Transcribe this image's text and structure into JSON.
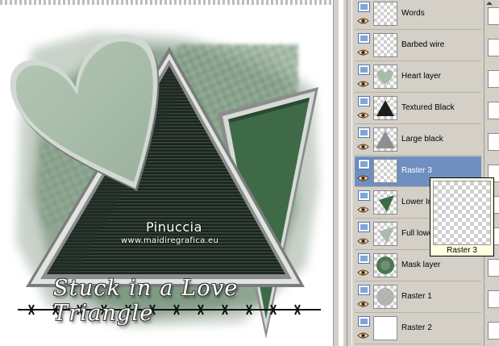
{
  "canvas": {
    "watermark_name": "Pinuccia",
    "watermark_url": "www.maidiregrafica.eu",
    "title_text": "Stuck in a Love Triangle"
  },
  "layers": [
    {
      "name": "Words",
      "thumb": "checker",
      "selected": false
    },
    {
      "name": "Barbed wire",
      "thumb": "checker",
      "selected": false
    },
    {
      "name": "Heart layer",
      "thumb": "heart",
      "selected": false
    },
    {
      "name": "Textured Black",
      "thumb": "triangle-black",
      "selected": false
    },
    {
      "name": "Large black",
      "thumb": "triangle-gray",
      "selected": false
    },
    {
      "name": "Raster 3",
      "thumb": "checker",
      "selected": true
    },
    {
      "name": "Lower In",
      "thumb": "triangle-green",
      "selected": false
    },
    {
      "name": "Full lowe",
      "thumb": "triangle-lightgreen",
      "selected": false
    },
    {
      "name": "Mask layer",
      "thumb": "mask-green",
      "selected": false
    },
    {
      "name": "Raster 1",
      "thumb": "mask-gray",
      "selected": false
    },
    {
      "name": "Raster 2",
      "thumb": "white",
      "selected": false
    }
  ],
  "popup": {
    "label": "Raster 3"
  },
  "colors": {
    "dark_green": "#1e2b22",
    "mid_green": "#3f6a48",
    "sage": "#a7bca9",
    "selection": "#6e8fc0"
  }
}
